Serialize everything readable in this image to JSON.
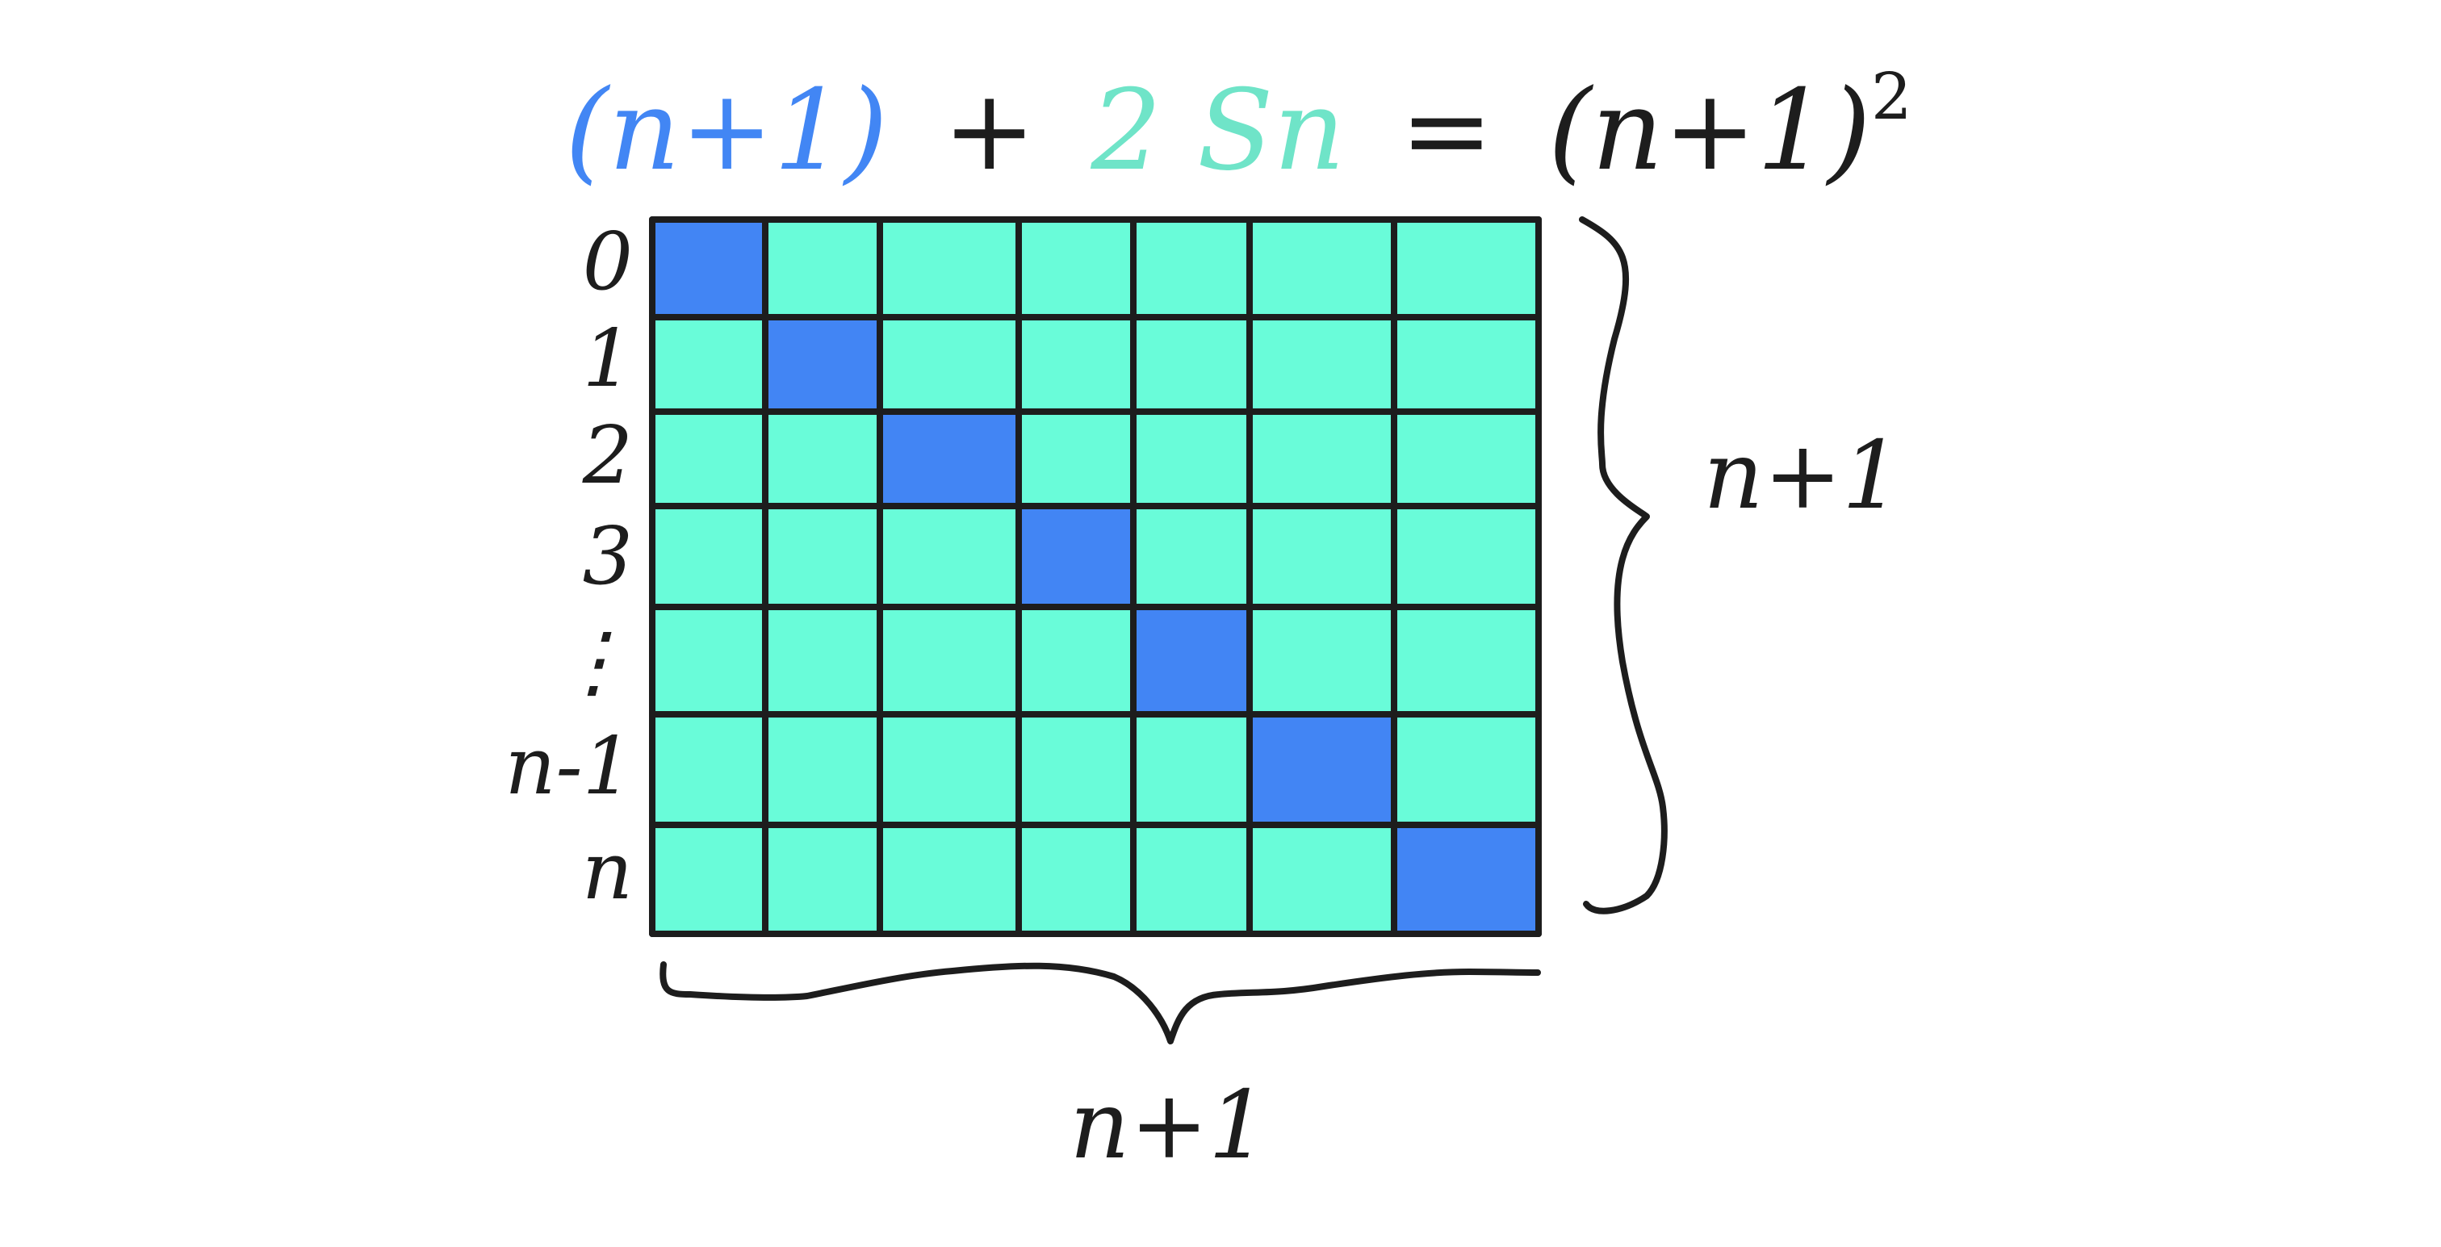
{
  "equation": {
    "part1": "(n+1)",
    "plus": "+",
    "part2": "2 Sn",
    "equals": "=",
    "part3": "(n+1)",
    "exponent": "2"
  },
  "grid": {
    "rows": 7,
    "cols": 7,
    "row_labels": [
      "0",
      "1",
      "2",
      "3",
      "⋮",
      "n-1",
      "n"
    ],
    "diagonal_color": "#4285f4",
    "cell_color": "#69fcd9",
    "line_color": "#1d1d1d"
  },
  "right_label": "n+1",
  "bottom_label": "n+1"
}
